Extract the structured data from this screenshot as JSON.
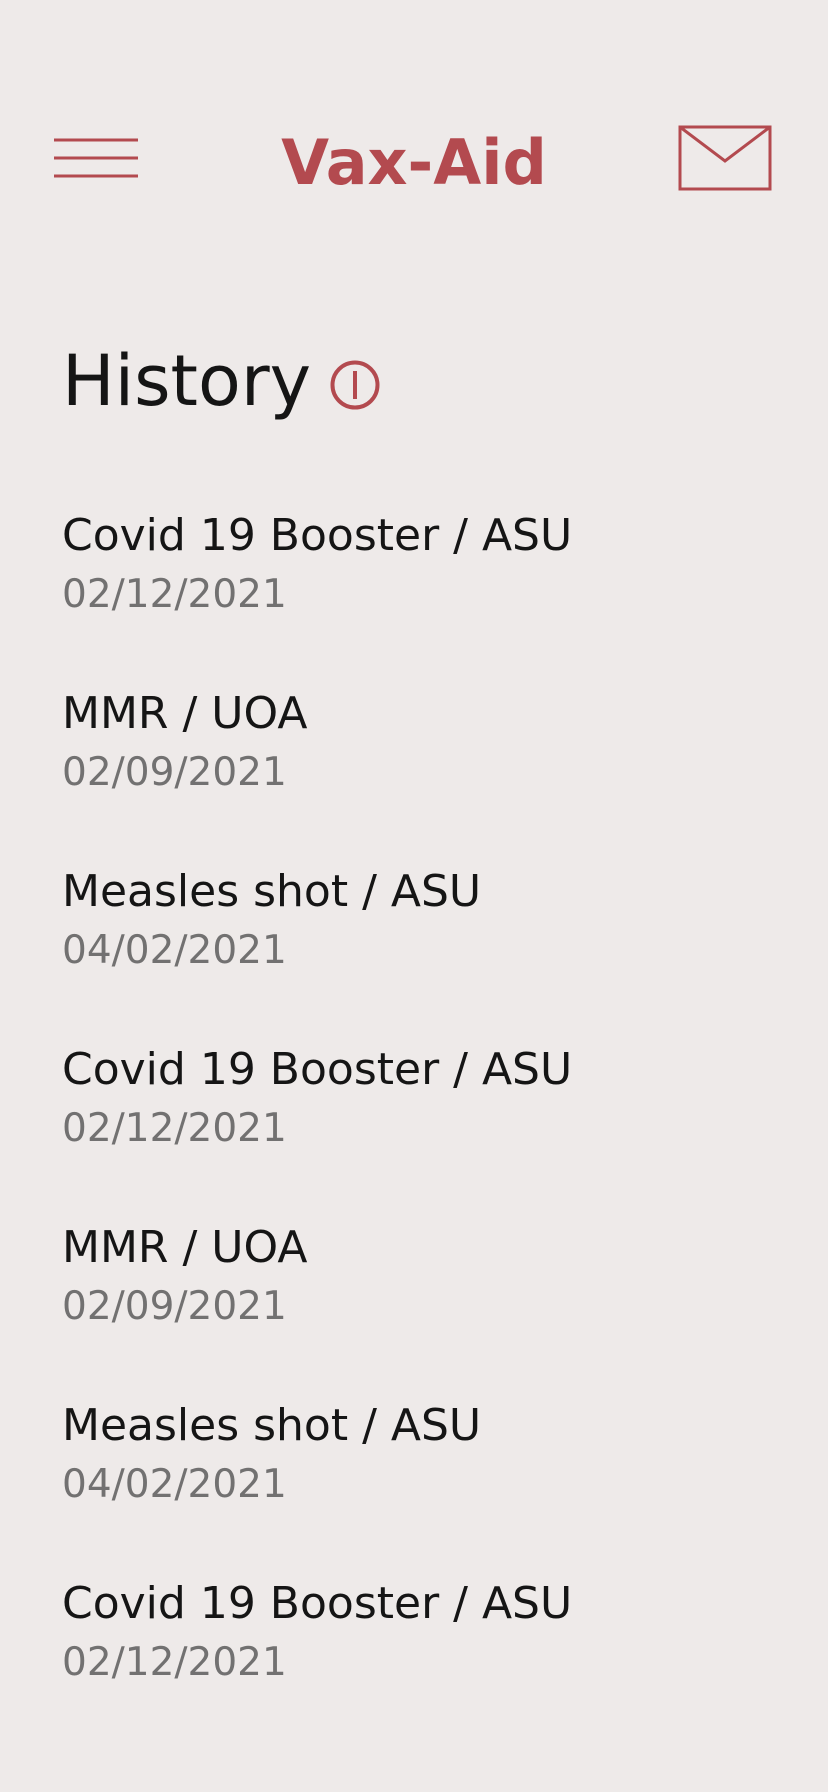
{
  "header": {
    "app_title": "Vax-Aid",
    "menu_icon": "hamburger-menu-icon",
    "mail_icon": "envelope-icon"
  },
  "page": {
    "title": "History",
    "info_icon": "info-icon"
  },
  "history": [
    {
      "title": "Covid 19 Booster / ASU",
      "date": "02/12/2021"
    },
    {
      "title": "MMR / UOA",
      "date": "02/09/2021"
    },
    {
      "title": "Measles shot / ASU",
      "date": "04/02/2021"
    },
    {
      "title": "Covid 19 Booster / ASU",
      "date": "02/12/2021"
    },
    {
      "title": "MMR / UOA",
      "date": "02/09/2021"
    },
    {
      "title": "Measles shot / ASU",
      "date": "04/02/2021"
    },
    {
      "title": "Covid 19 Booster / ASU",
      "date": "02/12/2021"
    }
  ],
  "colors": {
    "accent": "#b34a4f",
    "background": "#eeeae9",
    "primary_text": "#151515",
    "secondary_text": "#727171"
  }
}
